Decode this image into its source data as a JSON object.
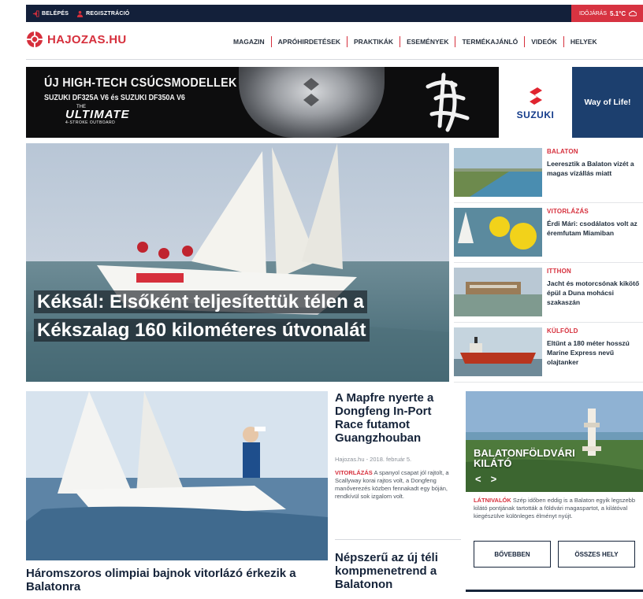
{
  "topbar": {
    "login": "BELÉPÉS",
    "register": "REGISZTRÁCIÓ",
    "weather_label": "IDŐJÁRÁS",
    "weather_value": "5.1°C"
  },
  "header": {
    "logo": "HAJOZAS.HU",
    "nav": [
      "MAGAZIN",
      "APRÓHIRDETÉSEK",
      "PRAKTIKÁK",
      "ESEMÉNYEK",
      "TERMÉKAJÁNLÓ",
      "VIDEÓK",
      "HELYEK"
    ]
  },
  "banner": {
    "line1": "ÚJ HIGH-TECH CSÚCSMODELLEK",
    "line2": "SUZUKI DF325A V6 és SUZUKI DF350A V6",
    "the": "THE",
    "ultimate": "ULTIMATE",
    "stroke": "4-STROKE OUTBOARD",
    "brand": "SUZUKI",
    "slogan": "Way of Life!"
  },
  "hero": {
    "title": "Kéksál: Elsőként teljesítettük télen a Kékszalag 160 kilométeres útvonalát"
  },
  "side": [
    {
      "category": "BALATON",
      "title": "Leeresztik a Balaton vizét a magas vízállás miatt"
    },
    {
      "category": "VITORLÁZÁS",
      "title": "Érdi Mári: csodálatos volt az éremfutam Miamiban"
    },
    {
      "category": "ITTHON",
      "title": "Jacht és motorcsónak kikötő épül a Duna mohácsi szakaszán"
    },
    {
      "category": "KÜLFÖLD",
      "title": "Eltűnt a 180 méter hosszú Marine Express nevű olajtanker"
    }
  ],
  "article2": {
    "title": "Háromszoros olimpiai bajnok vitorlázó érkezik a Balatonra"
  },
  "mid": {
    "title": "A Mapfre nyerte a Dongfeng In-Port Race futamot Guangzhouban",
    "meta": "Hajozas.hu - 2018. február 5.",
    "lead_category": "VITORLÁZÁS",
    "lead_text": "A spanyol csapat jól rajtolt, a Scallyway korai rajtos volt, a Dongfeng manőverezés közben fennakadt egy bóján, rendkívül sok izgalom volt.",
    "title2": "Népszerű az új téli kompmenetrend a Balatonon"
  },
  "card": {
    "title_line1": "BALATONFÖLDVÁRI",
    "title_line2": "KILÁTÓ",
    "prev": "<",
    "next": ">",
    "category": "LÁTNIVALÓK",
    "text": "Szép időben eddig is a Balaton egyik legszebb kilátó pontjának tartották a földvári magaspartot, a kilátóval kiegészülve különleges élményt nyújt.",
    "btn_more": "BŐVEBBEN",
    "btn_all": "ÖSSZES HELY"
  },
  "colors": {
    "accent": "#d62f3c",
    "navy": "#13203a"
  }
}
